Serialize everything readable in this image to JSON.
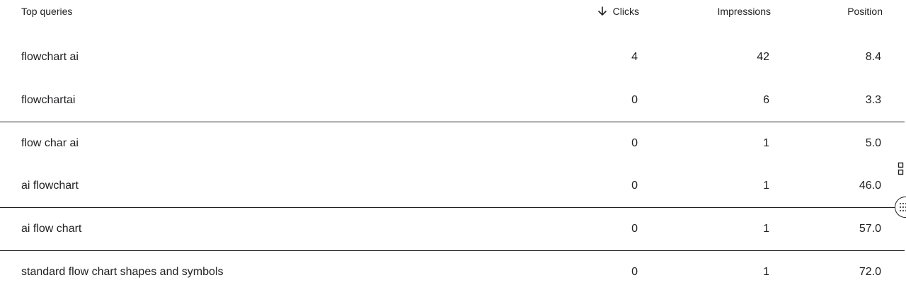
{
  "header": {
    "query_label": "Top queries",
    "clicks_label": "Clicks",
    "impressions_label": "Impressions",
    "position_label": "Position",
    "sort_icon": "arrow-down-icon"
  },
  "rows": [
    {
      "query": "flowchart ai",
      "clicks": "4",
      "impressions": "42",
      "position": "8.4"
    },
    {
      "query": "flowchartai",
      "clicks": "0",
      "impressions": "6",
      "position": "3.3"
    },
    {
      "query": "flow char ai",
      "clicks": "0",
      "impressions": "1",
      "position": "5.0"
    },
    {
      "query": "ai flowchart",
      "clicks": "0",
      "impressions": "1",
      "position": "46.0"
    },
    {
      "query": "ai flow chart",
      "clicks": "0",
      "impressions": "1",
      "position": "57.0"
    },
    {
      "query": "standard flow chart shapes and symbols",
      "clicks": "0",
      "impressions": "1",
      "position": "72.0"
    }
  ],
  "side_icons": [
    "panel-toggle-icon",
    "apps-icon"
  ]
}
